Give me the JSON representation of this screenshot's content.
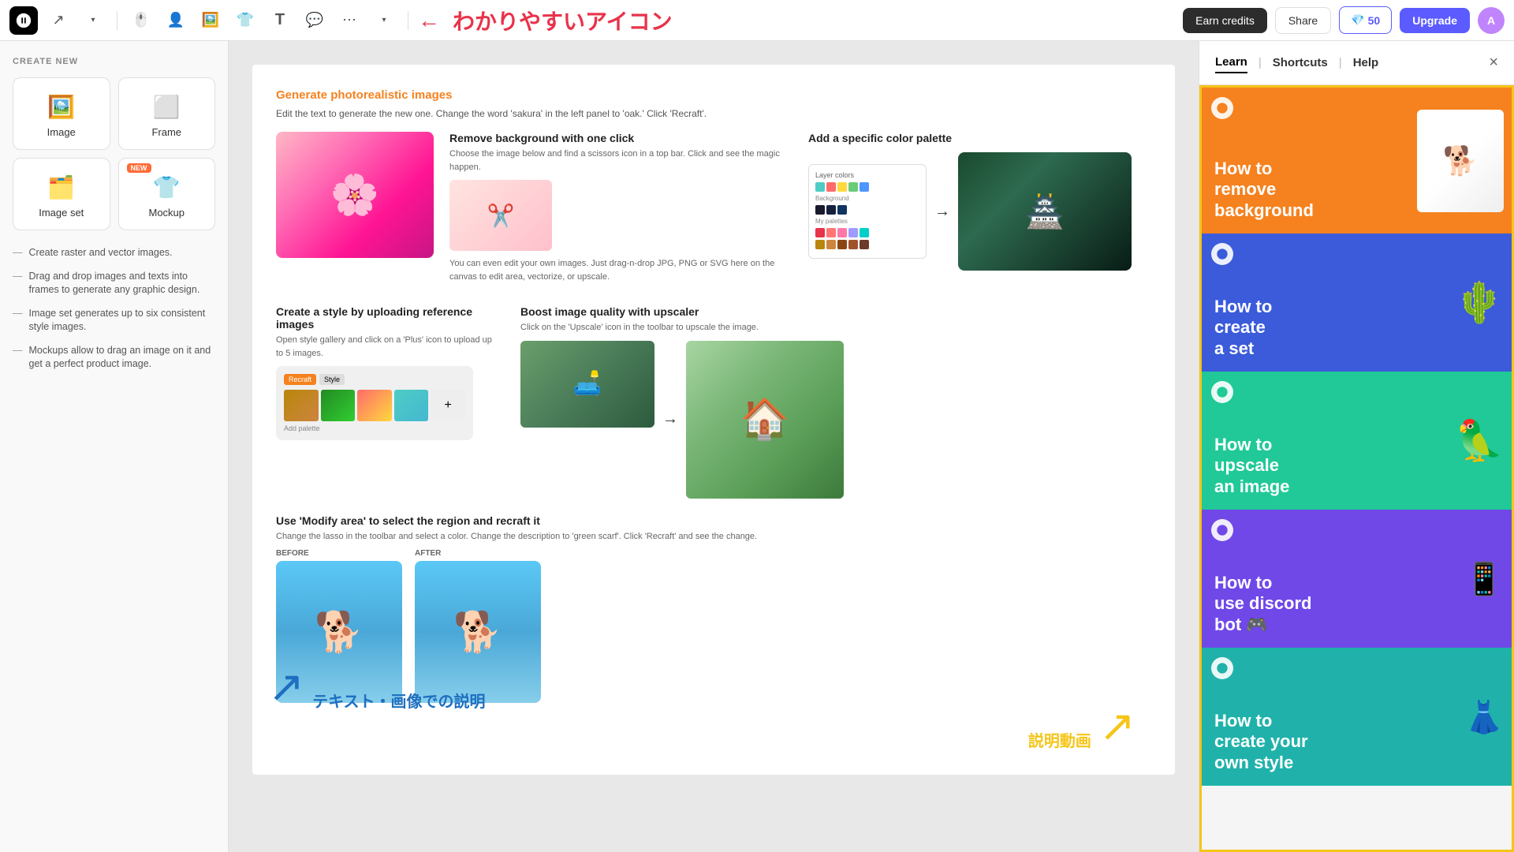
{
  "navbar": {
    "earn_credits": "Earn credits",
    "share": "Share",
    "credits_count": "50",
    "upgrade": "Upgrade",
    "title_arrow": "←",
    "title_jp": "わかりやすいアイコン",
    "avatar_initial": "A"
  },
  "left_panel": {
    "create_new": "CREATE NEW",
    "items": [
      {
        "id": "image",
        "label": "Image",
        "icon": "🖼️",
        "new": false
      },
      {
        "id": "frame",
        "label": "Frame",
        "icon": "⬜",
        "new": false
      },
      {
        "id": "image-set",
        "label": "Image set",
        "icon": "🗂️",
        "new": false
      },
      {
        "id": "mockup",
        "label": "Mockup",
        "icon": "👕",
        "new": false
      }
    ],
    "descriptions": [
      "Create raster and vector images.",
      "Drag and drop images and texts into frames to generate any graphic design.",
      "Image set generates up to six consistent style images.",
      "Mockups allow to drag an image on it and get a perfect product image."
    ]
  },
  "right_panel": {
    "tabs": [
      "Learn",
      "Shortcuts",
      "Help"
    ],
    "active_tab": "Learn",
    "close": "×",
    "border_color": "#f5c518",
    "tutorial_cards": [
      {
        "id": "remove-bg",
        "title": "How to remove background",
        "bg_color": "#f5821f",
        "thumb": "🐕"
      },
      {
        "id": "create-set",
        "title": "How to create a set",
        "bg_color": "#3b5bdb",
        "thumb": "🌵"
      },
      {
        "id": "upscale",
        "title": "How to upscale an image",
        "bg_color": "#20c997",
        "thumb": "🦜"
      },
      {
        "id": "discord",
        "title": "How to use discord bot",
        "bg_color": "#7048e8",
        "thumb": "📱"
      },
      {
        "id": "own-style",
        "title": "How to create your own style",
        "bg_color": "#20b2aa",
        "thumb": "👗"
      }
    ]
  },
  "canvas": {
    "section1": {
      "title": "Generate photorealistic images",
      "subtitle": "Edit the text to generate the new one. Change the word 'sakura' in the left panel to 'oak.' Click 'Recraft'."
    },
    "remove_bg": {
      "title": "Remove background with one click",
      "desc": "Choose the image below and find a scissors icon in a top bar. Click and see the magic happen.",
      "desc2": "You can even edit your own images. Just drag-n-drop JPG, PNG or SVG here on the canvas to edit area, vectorize, or upscale."
    },
    "color_palette": {
      "title": "Add a specific color palette",
      "layer_label": "Layer colors"
    },
    "create_style": {
      "title": "Create a style by uploading reference images",
      "desc": "Open style gallery and click on a 'Plus' icon to upload up to 5 images."
    },
    "upscale": {
      "title": "Boost image quality with upscaler",
      "desc": "Click on the 'Upscale' icon in the toolbar to upscale the image."
    },
    "modify": {
      "title": "Use 'Modify area' to select the region and recraft it",
      "desc": "Change the lasso in the toolbar and select a color. Change the description to 'green scarf'. Click 'Recraft' and see the change.",
      "before_label": "BEFORE",
      "after_label": "AFTER"
    },
    "annotation_text_jp": "テキスト・画像での説明",
    "annotation_video_jp": "説明動画"
  }
}
